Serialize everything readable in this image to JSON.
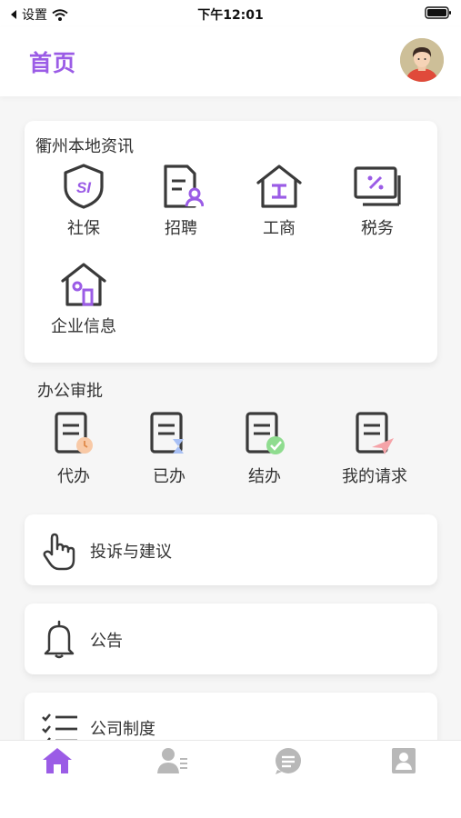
{
  "status_bar": {
    "back_label": "设置",
    "time": "下午12:01"
  },
  "header": {
    "title": "首页"
  },
  "local_news": {
    "title": "衢州本地资讯",
    "items": [
      {
        "label": "社保",
        "icon": "social-security-shield-icon"
      },
      {
        "label": "招聘",
        "icon": "recruitment-document-icon"
      },
      {
        "label": "工商",
        "icon": "business-house-icon"
      },
      {
        "label": "税务",
        "icon": "tax-screen-icon"
      },
      {
        "label": "企业信息",
        "icon": "company-info-house-icon"
      }
    ]
  },
  "office_approval": {
    "title": "办公审批",
    "items": [
      {
        "label": "代办",
        "icon": "todo-document-icon"
      },
      {
        "label": "已办",
        "icon": "done-document-icon"
      },
      {
        "label": "结办",
        "icon": "closed-document-icon"
      },
      {
        "label": "我的请求",
        "icon": "my-request-document-icon"
      }
    ]
  },
  "list": {
    "complaint": "投诉与建议",
    "notice": "公告",
    "policy": "公司制度"
  },
  "tab_bar": {
    "items": [
      "home-icon",
      "contacts-icon",
      "messages-icon",
      "profile-icon"
    ],
    "active_color": "#9b5ce6",
    "inactive_color": "#b8b8b8"
  },
  "colors": {
    "accent": "#9b5ce6",
    "icon_stroke": "#3a3a3a"
  }
}
